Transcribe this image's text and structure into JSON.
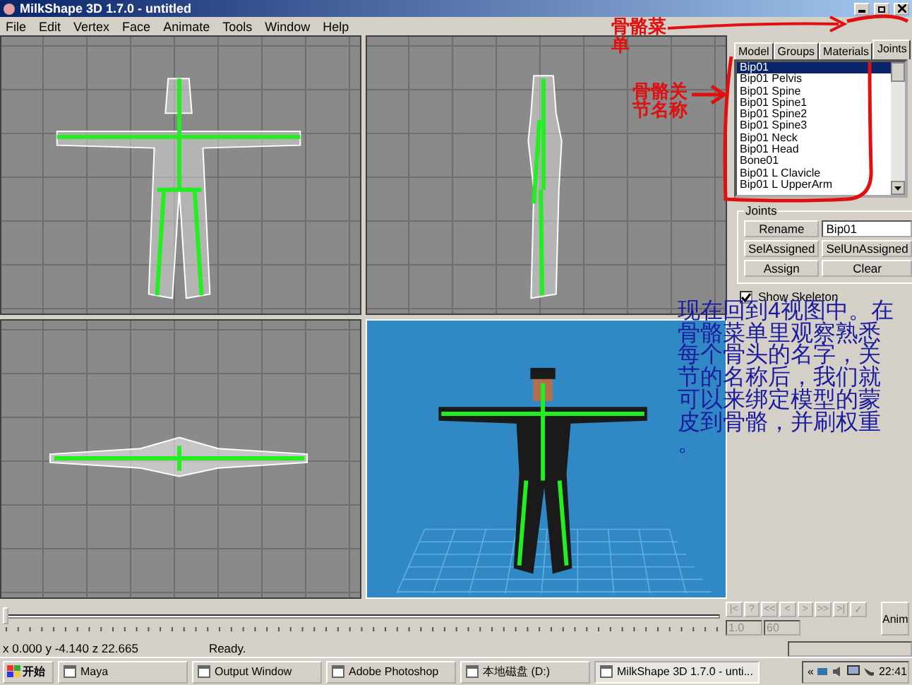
{
  "window": {
    "title": "MilkShape 3D 1.7.0 - untitled"
  },
  "menu": [
    "File",
    "Edit",
    "Vertex",
    "Face",
    "Animate",
    "Tools",
    "Window",
    "Help"
  ],
  "viewports": [
    {
      "kind": "front"
    },
    {
      "kind": "side"
    },
    {
      "kind": "top"
    },
    {
      "kind": "perspective"
    }
  ],
  "sidebar": {
    "tabs": [
      {
        "label": "Model",
        "selected": false
      },
      {
        "label": "Groups",
        "selected": false
      },
      {
        "label": "Materials",
        "selected": false
      },
      {
        "label": "Joints",
        "selected": true
      }
    ],
    "joint_list": [
      {
        "label": "Bip01",
        "selected": true
      },
      {
        "label": "Bip01 Pelvis",
        "selected": false
      },
      {
        "label": "Bip01 Spine",
        "selected": false
      },
      {
        "label": "Bip01 Spine1",
        "selected": false
      },
      {
        "label": "Bip01 Spine2",
        "selected": false
      },
      {
        "label": "Bip01 Spine3",
        "selected": false
      },
      {
        "label": "Bip01 Neck",
        "selected": false
      },
      {
        "label": "Bip01 Head",
        "selected": false
      },
      {
        "label": "Bone01",
        "selected": false
      },
      {
        "label": "Bip01 L Clavicle",
        "selected": false
      },
      {
        "label": "Bip01 L UpperArm",
        "selected": false
      }
    ],
    "joints_group": {
      "title": "Joints",
      "rename": "Rename",
      "name_value": "Bip01",
      "buttons": [
        "SelAssigned",
        "SelUnAssigned",
        "Assign",
        "Clear"
      ]
    },
    "show_skeleton": {
      "label": "Show Skeleton",
      "checked": true
    }
  },
  "timeline": {
    "level": 0,
    "buttons": [
      "|<",
      "?",
      "<<",
      "<",
      ">",
      ">>",
      ">|",
      "✓"
    ],
    "start": "1.0",
    "end": "60",
    "anim": "Anim"
  },
  "status": {
    "coords": "x 0.000 y -4.140 z 22.665",
    "message": "Ready."
  },
  "taskbar": {
    "start": "开始",
    "items": [
      {
        "label": "Maya",
        "selected": false
      },
      {
        "label": "Output Window",
        "selected": false
      },
      {
        "label": "Adobe Photoshop",
        "selected": false
      },
      {
        "label": "本地磁盘 (D:)",
        "selected": false
      },
      {
        "label": "MilkShape 3D 1.7.0 - unti...",
        "selected": true
      }
    ],
    "tray_arrow": "«",
    "clock": "22:41"
  },
  "annotations": {
    "menu_label": [
      "骨骼菜",
      "单"
    ],
    "joint_label": [
      "骨骼关",
      "节名称"
    ],
    "note": [
      "现在回到4视图中。在",
      "骨骼菜单里观察熟悉",
      "每个骨头的名字，关",
      "节的名称后，我们就",
      "可以来绑定模型的蒙",
      "皮到骨骼，并刷权重",
      "。"
    ]
  }
}
